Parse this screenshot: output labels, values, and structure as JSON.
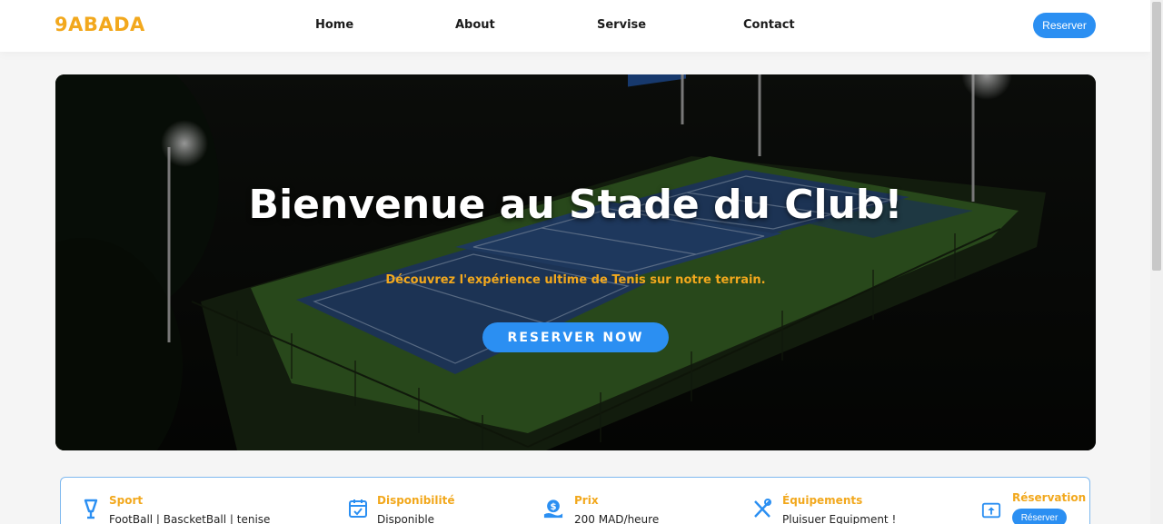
{
  "header": {
    "logo": "9ABADA",
    "nav": [
      {
        "label": "Home"
      },
      {
        "label": "About"
      },
      {
        "label": "Servise"
      },
      {
        "label": "Contact"
      }
    ],
    "cta_label": "Reserver"
  },
  "hero": {
    "title": "Bienvenue au Stade du Club!",
    "subtitle": "Découvrez l'expérience ultime de Tenis sur notre terrain.",
    "button_label": "RESERVER NOW"
  },
  "info": {
    "sport": {
      "label": "Sport",
      "value": "FootBall | BascketBall | tenise",
      "icon": "trophy-icon"
    },
    "availability": {
      "label": "Disponibilité",
      "value": "Disponible",
      "icon": "calendar-check-icon"
    },
    "price": {
      "label": "Prix",
      "value": "200 MAD/heure",
      "icon": "money-hand-icon"
    },
    "equipment": {
      "label": "Équipements",
      "value": "Pluisuer Equipment !",
      "icon": "tools-icon"
    },
    "reservation": {
      "label": "Réservation",
      "button_label": "Réserver",
      "icon": "upload-box-icon"
    }
  },
  "colors": {
    "accent": "#f2a81d",
    "primary": "#2b8ff2"
  }
}
